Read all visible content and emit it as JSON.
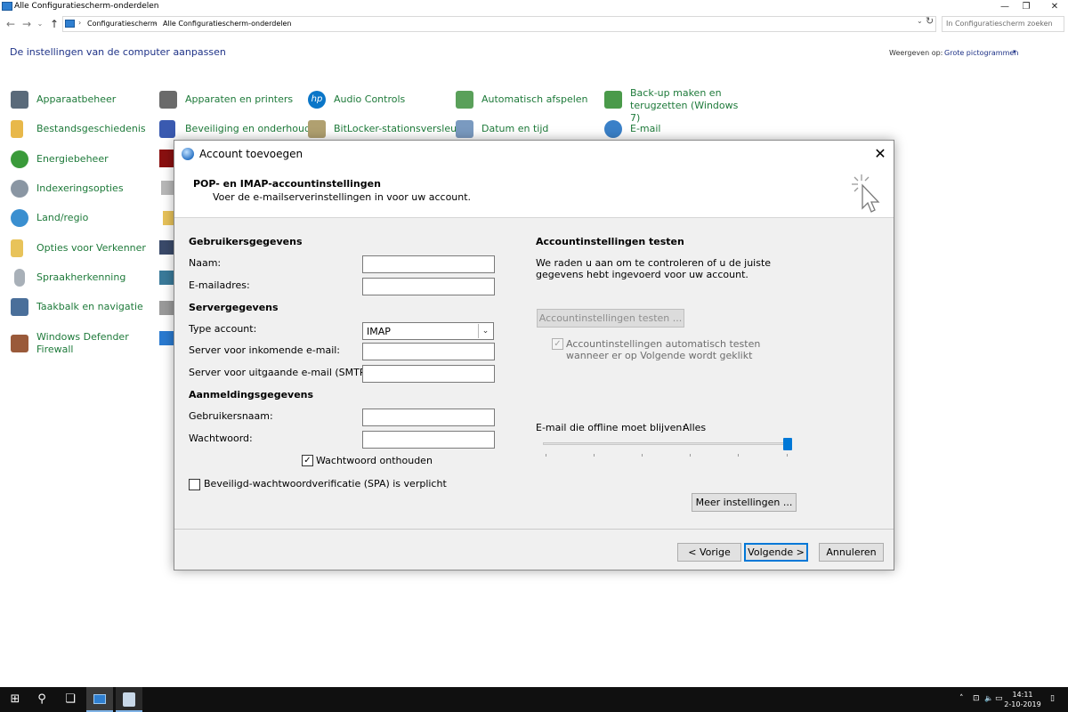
{
  "window": {
    "title": "Alle Configuratiescherm-onderdelen",
    "min_glyph": "—",
    "max_glyph": "❐",
    "close_glyph": "✕"
  },
  "address": {
    "back_glyph": "←",
    "forward_glyph": "→",
    "recent_glyph": "⌄",
    "up_glyph": "↑",
    "breadcrumbs": [
      "Configuratiescherm",
      "Alle Configuratiescherm-onderdelen"
    ],
    "chevron": "›",
    "dropdown_glyph": "⌄",
    "refresh_glyph": "↻",
    "search_placeholder": "In Configuratiescherm zoeken"
  },
  "page": {
    "title": "De instellingen van de computer aanpassen",
    "view_label": "Weergeven op:",
    "view_value": "Grote pictogrammen",
    "view_chevron": "▾"
  },
  "items": {
    "col1": [
      {
        "label": "Apparaatbeheer",
        "icon": "device-manager-icon",
        "color": "#5a6a7a"
      },
      {
        "label": "Bestandsgeschiedenis",
        "icon": "file-history-icon",
        "color": "#e8b84a"
      },
      {
        "label": "Energiebeheer",
        "icon": "power-options-icon",
        "color": "#3a9a3a"
      },
      {
        "label": "Indexeringsopties",
        "icon": "indexing-options-icon",
        "color": "#8a96a3"
      },
      {
        "label": "Land/regio",
        "icon": "region-icon",
        "color": "#3a8fd0"
      },
      {
        "label": "Opties voor Verkenner",
        "icon": "explorer-options-icon",
        "color": "#e8c35a"
      },
      {
        "label": "Spraakherkenning",
        "icon": "speech-icon",
        "color": "#a8b0b8"
      },
      {
        "label": "Taakbalk en navigatie",
        "icon": "taskbar-icon",
        "color": "#4a6f9a"
      },
      {
        "label": "Windows Defender Firewall",
        "icon": "firewall-icon",
        "color": "#9a5a3a"
      }
    ],
    "col2_top": [
      {
        "label": "Apparaten en printers",
        "icon": "devices-printers-icon",
        "color": "#6a6a6a"
      },
      {
        "label": "Beveiliging en onderhoud",
        "icon": "security-flag-icon",
        "color": "#3a5ab0"
      }
    ],
    "col2_partial": [
      "flash-icon",
      "partial-icon",
      "folder-icon",
      "display-icon",
      "network-icon",
      "printer-icon",
      "windows-icon"
    ],
    "col3": [
      {
        "label": "Audio Controls",
        "icon": "hp-icon",
        "color": "#0a76c8"
      },
      {
        "label": "BitLocker-stationsversleut...",
        "icon": "bitlocker-icon",
        "color": "#b0a070"
      }
    ],
    "col4": [
      {
        "label": "Automatisch afspelen",
        "icon": "autoplay-icon",
        "color": "#5aa05a"
      },
      {
        "label": "Datum en tijd",
        "icon": "date-time-icon",
        "color": "#7a9ac0"
      }
    ],
    "col5": [
      {
        "label_line1": "Back-up maken en",
        "label_line2": "terugzetten (Windows 7)",
        "icon": "backup-icon",
        "color": "#4a9a4a"
      },
      {
        "label": "E-mail",
        "icon": "mail-globe-icon",
        "color": "#3a80c8"
      }
    ]
  },
  "dialog": {
    "title": "Account toevoegen",
    "close_glyph": "✕",
    "header_title": "POP- en IMAP-accountinstellingen",
    "header_subtitle": "Voer de e-mailserverinstellingen in voor uw account.",
    "user_section": "Gebruikersgegevens",
    "name_label": "Naam:",
    "email_label": "E-mailadres:",
    "server_section": "Servergegevens",
    "account_type_label": "Type account:",
    "account_type_value": "IMAP",
    "account_type_dd": "⌄",
    "incoming_label": "Server voor inkomende e-mail:",
    "outgoing_label": "Server voor uitgaande e-mail (SMTP):",
    "login_section": "Aanmeldingsgegevens",
    "username_label": "Gebruikersnaam:",
    "password_label": "Wachtwoord:",
    "remember_label": "Wachtwoord onthouden",
    "remember_check": "✓",
    "spa_label": "Beveiligd-wachtwoordverificatie (SPA) is verplicht",
    "test_section": "Accountinstellingen testen",
    "test_desc_line1": "We raden u aan om te controleren of u de juiste",
    "test_desc_line2": "gegevens hebt ingevoerd voor uw account.",
    "test_button": "Accountinstellingen testen ...",
    "auto_test_line1": "Accountinstellingen automatisch testen",
    "auto_test_line2": "wanneer er op Volgende wordt geklikt",
    "auto_test_check": "✓",
    "offline_label": "E-mail die offline moet blijven:",
    "offline_value": "Alles",
    "offline_level": 1.0,
    "more_settings": "Meer instellingen ...",
    "back_button": "< Vorige",
    "next_button": "Volgende >",
    "cancel_button": "Annuleren"
  },
  "taskbar": {
    "start_glyph": "⊞",
    "search_glyph": "⚲",
    "taskview_glyph": "❏",
    "tray_up": "˄",
    "tray_network": "⊡",
    "tray_volume": "🔈",
    "tray_lang": "▭",
    "time": "14:11",
    "date": "2-10-2019",
    "notify_glyph": "▯"
  }
}
